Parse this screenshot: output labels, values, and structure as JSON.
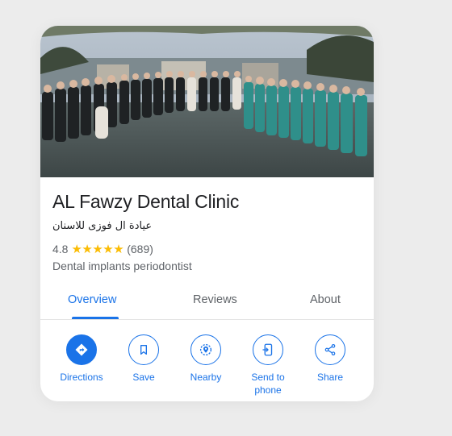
{
  "place": {
    "name": "AL Fawzy Dental Clinic",
    "arabic_name": "عيادة ال فوزى للاسنان",
    "rating": "4.8",
    "stars": "★★★★★",
    "review_count": "(689)",
    "category": "Dental implants periodontist"
  },
  "tabs": [
    {
      "label": "Overview",
      "active": true
    },
    {
      "label": "Reviews",
      "active": false
    },
    {
      "label": "About",
      "active": false
    }
  ],
  "actions": [
    {
      "label": "Directions",
      "icon": "directions-icon"
    },
    {
      "label": "Save",
      "icon": "bookmark-icon"
    },
    {
      "label": "Nearby",
      "icon": "nearby-icon"
    },
    {
      "label": "Send to phone",
      "icon": "send-to-phone-icon"
    },
    {
      "label": "Share",
      "icon": "share-icon"
    }
  ],
  "colors": {
    "accent": "#1a73e8",
    "star": "#fbbc04",
    "text": "#202124",
    "secondary": "#5f6368"
  }
}
